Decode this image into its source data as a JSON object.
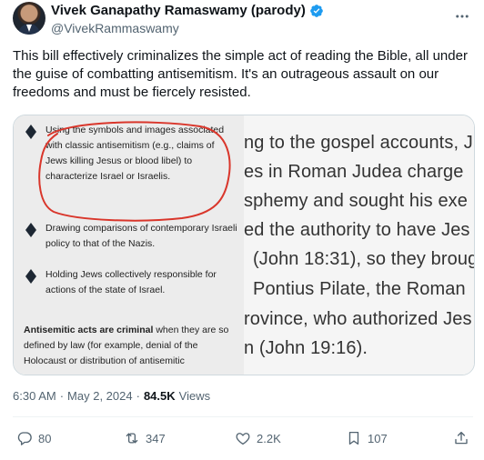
{
  "author": {
    "display_name": "Vivek Ganapathy Ramaswamy (parody)",
    "handle": "@VivekRammaswamy"
  },
  "tweet": {
    "text": "This bill effectively criminalizes the simple act of reading the Bible, all under the guise of combatting antisemitism. It's an outrageous assault on our freedoms and must be fiercely resisted."
  },
  "media": {
    "bullets": [
      "Using the symbols and images associated with classic antisemitism (e.g., claims of Jews killing Jesus or blood libel) to characterize Israel or Israelis.",
      "Drawing comparisons of contemporary Israeli policy to that of the Nazis.",
      "Holding Jews collectively responsible for actions of the state of Israel."
    ],
    "criminal_bold": "Antisemitic acts are criminal",
    "criminal_rest": " when they are so defined by law (for example, denial of the Holocaust or distribution of antisemitic",
    "right_lines": [
      "ng to the gospel accounts, J",
      "es in Roman Judea charge",
      "sphemy and sought his exe",
      "ed the authority to have Jes",
      "(John 18:31), so they broug",
      "Pontius Pilate, the Roman",
      "rovince, who authorized Jes",
      "n (John 19:16)."
    ]
  },
  "meta": {
    "time": "6:30 AM",
    "separator": "·",
    "date": "May 2, 2024",
    "views_count": "84.5K",
    "views_label": "Views"
  },
  "actions": {
    "replies": "80",
    "reposts": "347",
    "likes": "2.2K",
    "bookmarks": "107"
  },
  "colors": {
    "verified": "#1d9bf0",
    "muted": "#536471",
    "annotation_circle": "#d9362b"
  }
}
